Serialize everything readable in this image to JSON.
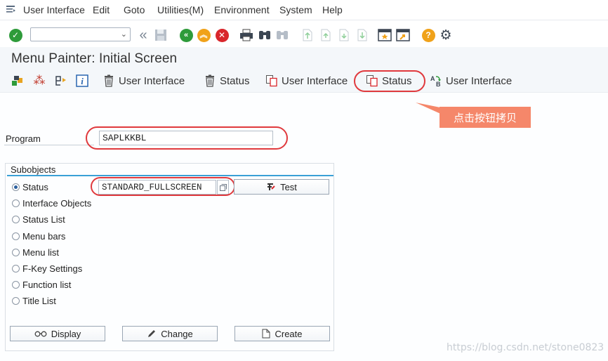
{
  "menubar": {
    "items": [
      "User Interface",
      "Edit",
      "Goto",
      "Utilities(M)",
      "Environment",
      "System",
      "Help"
    ]
  },
  "toolbar": {
    "command_field_value": ""
  },
  "page": {
    "title": "Menu Painter: Initial Screen"
  },
  "app_toolbar": {
    "user_interface_delete": "User Interface",
    "status_delete": "Status",
    "user_interface_copy": "User Interface",
    "status_copy": "Status",
    "user_interface_rename": "User Interface"
  },
  "callout": {
    "text": "点击按钮拷贝"
  },
  "program": {
    "label": "Program",
    "value": "SAPLKKBL"
  },
  "subobjects": {
    "title": "Subobjects",
    "status_value": "STANDARD_FULLSCREEN",
    "test_label": "Test",
    "options": [
      {
        "label": "Status",
        "selected": true
      },
      {
        "label": "Interface Objects",
        "selected": false
      },
      {
        "label": "Status List",
        "selected": false
      },
      {
        "label": "Menu bars",
        "selected": false
      },
      {
        "label": "Menu list",
        "selected": false
      },
      {
        "label": "F-Key Settings",
        "selected": false
      },
      {
        "label": "Function list",
        "selected": false
      },
      {
        "label": "Title List",
        "selected": false
      }
    ]
  },
  "actions": {
    "display": "Display",
    "change": "Change",
    "create": "Create"
  },
  "watermark": "https://blog.csdn.net/stone0823",
  "colors": {
    "highlight": "#e0393d",
    "callout": "#f5876a",
    "accent_rule": "#3aa0d6"
  }
}
